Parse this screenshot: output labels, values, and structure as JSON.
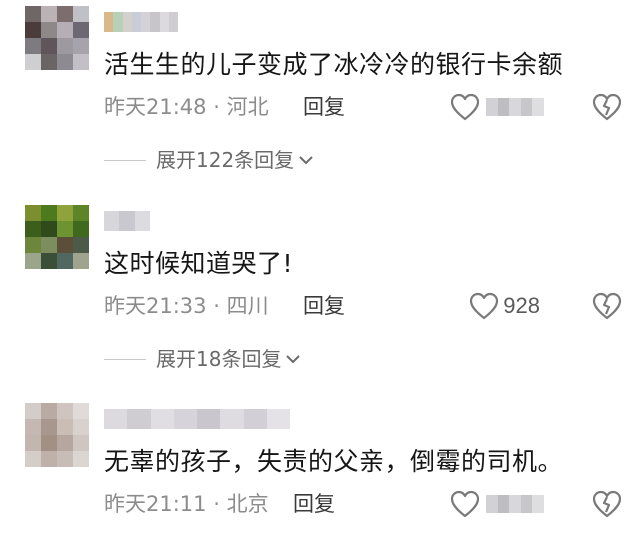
{
  "comments": [
    {
      "text": "活生生的儿子变成了冰冷冷的银行卡余额",
      "time": "昨天21:48",
      "location": "河北",
      "reply_label": "回复",
      "likes": "",
      "expand_label": "展开122条回复",
      "avatar_colors": [
        "#6e6766",
        "#bab2b5",
        "#7c6d6e",
        "#c0c0c7",
        "#4a3c3a",
        "#8f8888",
        "#b6aeb6",
        "#6c6772",
        "#7d7b80",
        "#5f555a",
        "#9e99a0",
        "#a7a3ac",
        "#cfcfd2",
        "#6b6465",
        "#8d8a92",
        "#c2c0c6"
      ],
      "name_colors": [
        "#d9b88a",
        "#b7d1b9",
        "#d4d0cb",
        "#c9cdd8",
        "#d5d2d7",
        "#c7c5c9",
        "#dcdadf",
        "#cfcdd2"
      ]
    },
    {
      "text": "这时候知道哭了!",
      "time": "昨天21:33",
      "location": "四川",
      "reply_label": "回复",
      "likes": "928",
      "expand_label": "展开18条回复",
      "avatar_colors": [
        "#7b8f2e",
        "#4d7a1c",
        "#8ea43a",
        "#5e8428",
        "#3c5e1a",
        "#2f4b1b",
        "#6d9430",
        "#3f6a1e",
        "#6c863c",
        "#7c8d5e",
        "#5b4f3a",
        "#4e5a48",
        "#9aa58a",
        "#3b4e38",
        "#506860",
        "#a0a48e"
      ],
      "name_colors": [
        "#d7d6da",
        "#c9c8ce",
        "#dcdbe0"
      ]
    },
    {
      "text": "无辜的孩子，失责的父亲，倒霉的司机。",
      "time": "昨天21:11",
      "location": "北京",
      "reply_label": "回复",
      "likes": "",
      "avatar_colors": [
        "#d3ccc8",
        "#b9aaa4",
        "#cfc4bf",
        "#e0dbd8",
        "#c5b7b2",
        "#a7978e",
        "#c9bdb5",
        "#d8d1cd",
        "#c2b6ae",
        "#a39084",
        "#b5a79f",
        "#cfc6c1",
        "#d5cdc8",
        "#bfb1aa",
        "#c7bcb6",
        "#dcd6d2"
      ],
      "name_colors": [
        "#dcdadf",
        "#cfcdd2",
        "#e0dee3",
        "#d6d4da",
        "#c9c7cd",
        "#dedce1",
        "#d2d0d6",
        "#e4e2e6"
      ]
    }
  ],
  "icons": {
    "like": "heart-outline-icon",
    "dislike": "broken-heart-icon",
    "expand": "chevron-down-icon"
  },
  "colors": {
    "text": "#161616",
    "meta": "#8c8c8c",
    "icon": "#7a7a7a"
  }
}
